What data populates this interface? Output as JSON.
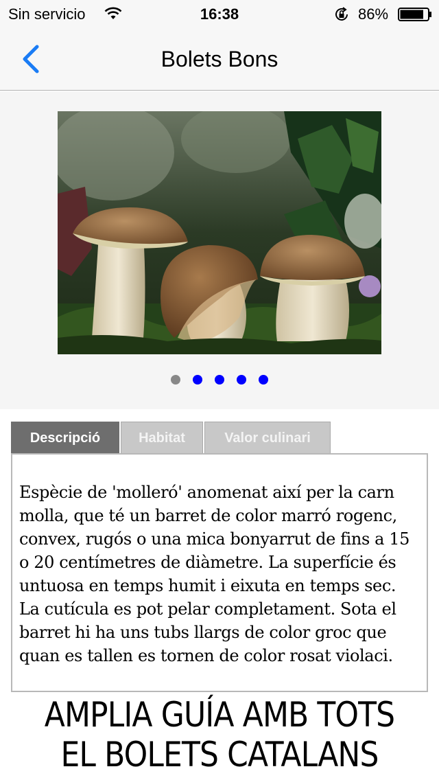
{
  "status_bar": {
    "carrier": "Sin servicio",
    "time": "16:38",
    "battery_percent": "86%",
    "battery_level": 0.86,
    "icons": [
      "wifi-icon",
      "rotation-lock-icon",
      "battery-icon"
    ]
  },
  "nav": {
    "title": "Bolets Bons",
    "back_icon": "chevron-left-icon",
    "accent_color": "#1a7cf5"
  },
  "gallery": {
    "image": "photo of three porcini mushrooms on moss",
    "page_count": 5,
    "current_page": 1,
    "dot_color": "#0000ff",
    "active_dot_color": "#888888"
  },
  "tabs": [
    {
      "label": "Descripció",
      "active": true
    },
    {
      "label": "Habitat",
      "active": false
    },
    {
      "label": "Valor culinari",
      "active": false
    }
  ],
  "description": "Espècie de 'molleró' anomenat així per la carn molla, que té un barret de color marró rogenc, convex, rugós o una mica bonyarrut de fins a 15 o 20 centímetres de diàmetre. La superfície és untuosa en temps humit i eixuta en temps sec. La cutícula es pot pelar completament. Sota el barret hi ha uns tubs llargs de color groc que quan es tallen es tornen de color rosat violaci.",
  "promo": {
    "line1": "AMPLIA GUÍA AMB TOTS",
    "line2": "EL BOLETS CATALANS"
  }
}
